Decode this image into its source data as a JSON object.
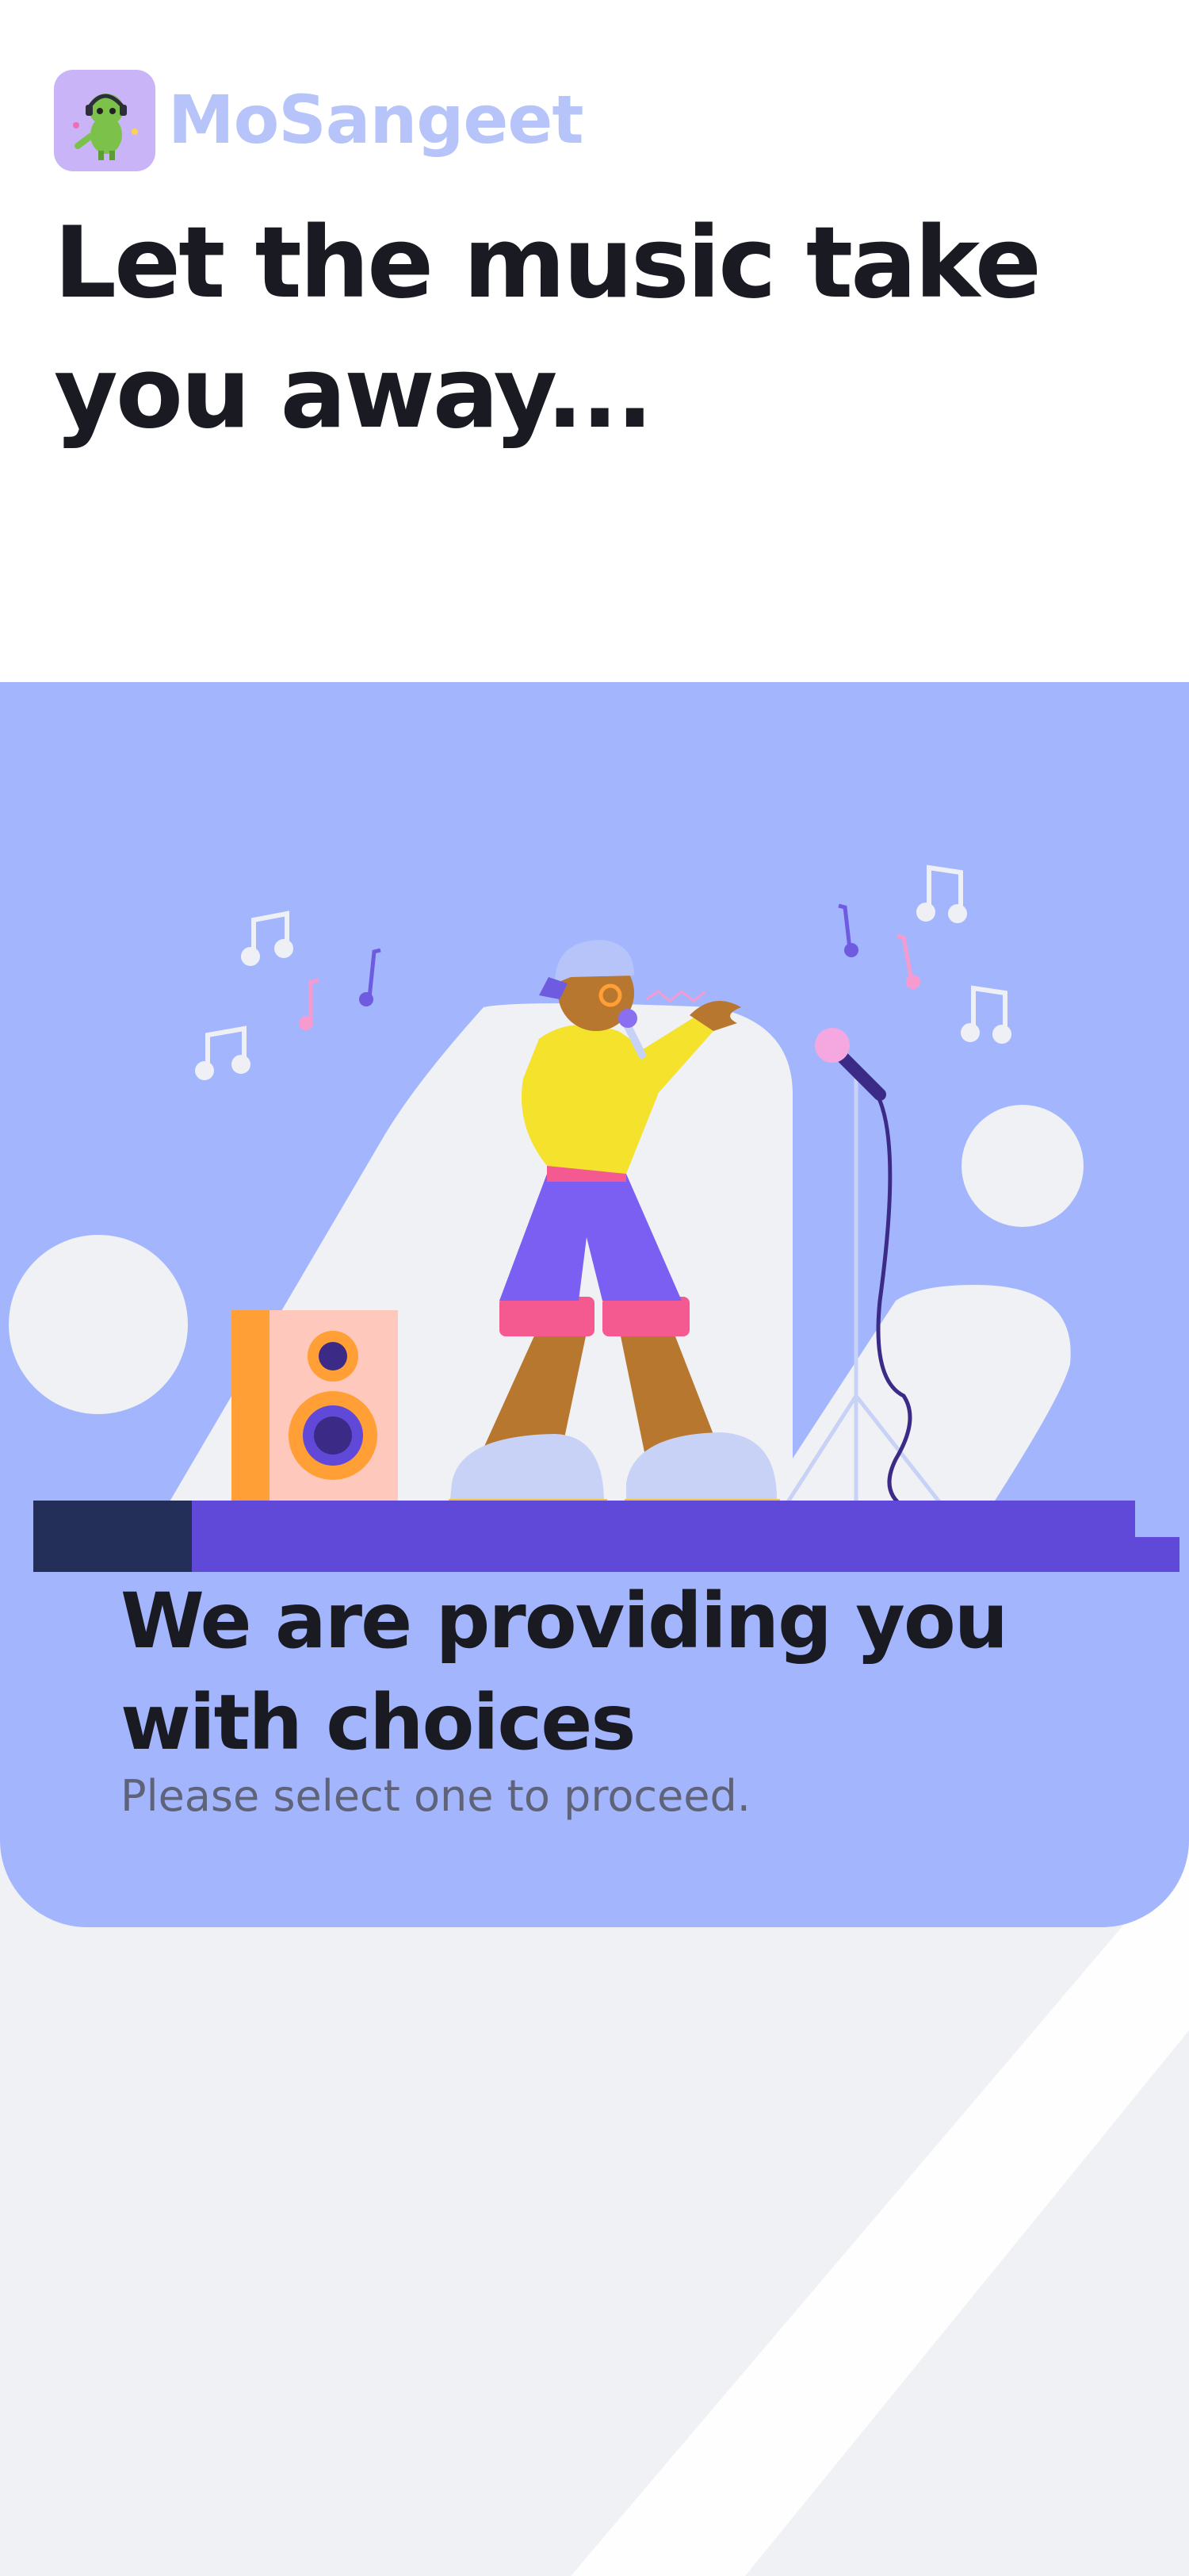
{
  "header": {
    "app_name": "MoSangeet",
    "headline": "Let the music take you away..."
  },
  "hero": {
    "title": "We are providing you with choices",
    "subtitle": "Please select one to proceed."
  },
  "colors": {
    "page_background": "#eff1f4",
    "top_background": "#ffffff",
    "card_background": "#a3b5fd",
    "brand_text": "#b7c4f9",
    "headline_text": "#1a1b22",
    "subtitle_text": "#5e6378",
    "stage": "#6048d8",
    "stage_dark": "#232f58"
  },
  "icons": {
    "app_logo": "dinosaur-music-icon",
    "illustration": "singer-on-stage-illustration"
  }
}
